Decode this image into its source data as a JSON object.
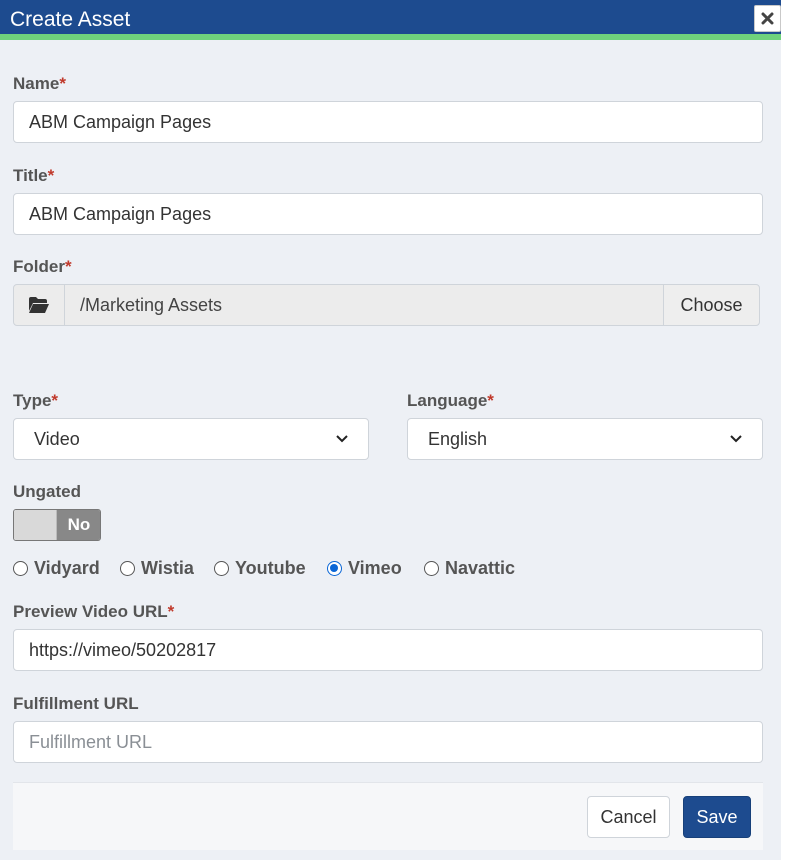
{
  "header": {
    "title": "Create Asset"
  },
  "colors": {
    "header_bg": "#1d4b8f",
    "accent_bar": "#6fd27c",
    "required": "#c0392b",
    "primary": "#1d4b8f",
    "radio_checked": "#0a66d6"
  },
  "fields": {
    "name": {
      "label": "Name",
      "required_mark": "*",
      "value": "ABM Campaign Pages"
    },
    "title": {
      "label": "Title",
      "required_mark": "*",
      "value": "ABM Campaign Pages"
    },
    "folder": {
      "label": "Folder",
      "required_mark": "*",
      "path": "/Marketing Assets",
      "choose_label": "Choose"
    },
    "type": {
      "label": "Type",
      "required_mark": "*",
      "value": "Video"
    },
    "language": {
      "label": "Language",
      "required_mark": "*",
      "value": "English"
    },
    "ungated": {
      "label": "Ungated",
      "state": "No"
    },
    "providers": {
      "options": [
        "Vidyard",
        "Wistia",
        "Youtube",
        "Vimeo",
        "Navattic"
      ],
      "selected": "Vimeo"
    },
    "preview_url": {
      "label": "Preview Video URL",
      "required_mark": "*",
      "value": "https://vimeo/50202817"
    },
    "fulfillment_url": {
      "label": "Fulfillment URL",
      "placeholder": "Fulfillment URL"
    }
  },
  "footer": {
    "cancel_label": "Cancel",
    "save_label": "Save"
  }
}
